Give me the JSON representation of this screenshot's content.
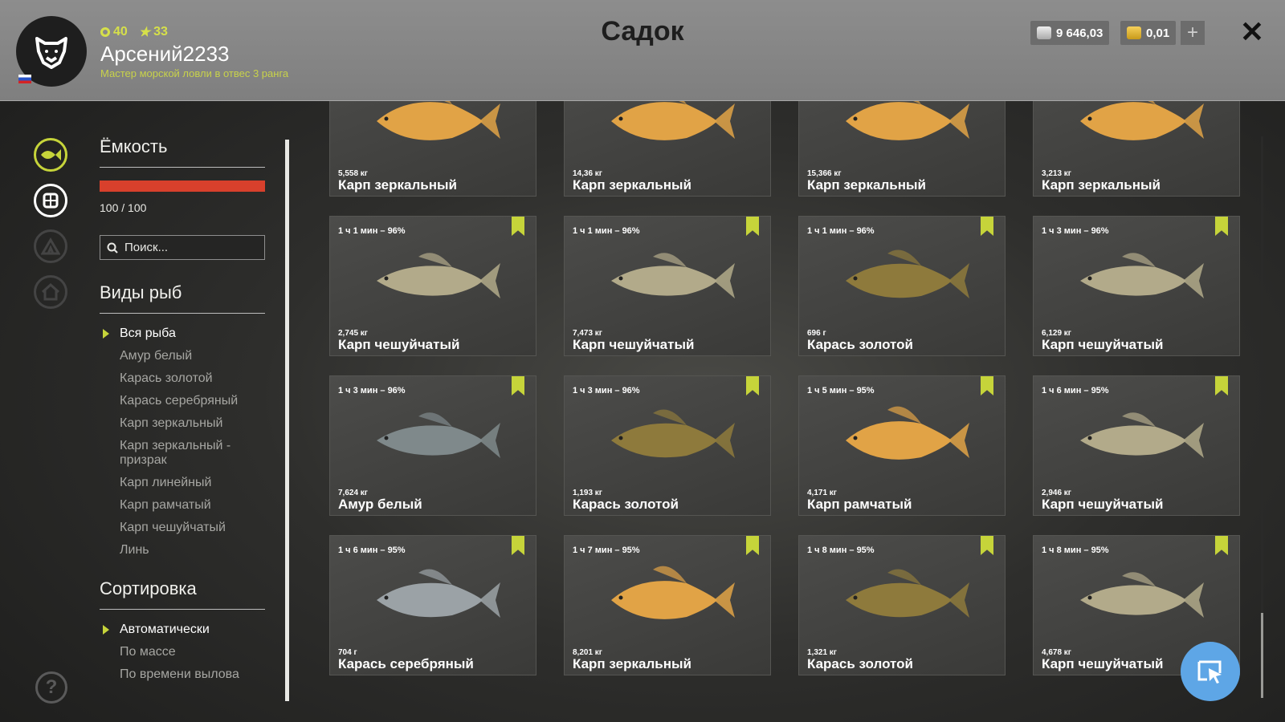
{
  "header": {
    "title": "Садок",
    "player": {
      "level": "40",
      "rank": "33",
      "name": "Арсений2233",
      "subtitle": "Мастер морской ловли в отвес 3 ранга"
    },
    "currency": {
      "silver": "9 646,03",
      "gold": "0,01"
    },
    "plus_label": "+",
    "close_label": "✕"
  },
  "sidebar": {
    "capacity_title": "Ёмкость",
    "capacity_value": "100 / 100",
    "capacity_fraction": 1.0,
    "search_placeholder": "Поиск...",
    "species_title": "Виды рыб",
    "species": [
      "Вся рыба",
      "Амур белый",
      "Карась золотой",
      "Карась серебряный",
      "Карп зеркальный",
      "Карп зеркальный - призрак",
      "Карп линейный",
      "Карп рамчатый",
      "Карп чешуйчатый",
      "Линь"
    ],
    "sort_title": "Сортировка",
    "sort_options": [
      "Автоматически",
      "По массе",
      "По времени вылова"
    ],
    "help_label": "?"
  },
  "fish": [
    {
      "time": "",
      "weight": "5,558 кг",
      "name": "Карп зеркальный",
      "kind": "mirror",
      "marked": false
    },
    {
      "time": "",
      "weight": "14,36 кг",
      "name": "Карп зеркальный",
      "kind": "mirror",
      "marked": false
    },
    {
      "time": "",
      "weight": "15,366 кг",
      "name": "Карп зеркальный",
      "kind": "mirror",
      "marked": false
    },
    {
      "time": "",
      "weight": "3,213 кг",
      "name": "Карп зеркальный",
      "kind": "mirror",
      "marked": false
    },
    {
      "time": "1 ч 1 мин – 96%",
      "weight": "2,745 кг",
      "name": "Карп чешуйчатый",
      "kind": "common",
      "marked": true
    },
    {
      "time": "1 ч 1 мин – 96%",
      "weight": "7,473 кг",
      "name": "Карп чешуйчатый",
      "kind": "common",
      "marked": true
    },
    {
      "time": "1 ч 1 мин – 96%",
      "weight": "696 г",
      "name": "Карась золотой",
      "kind": "crucian",
      "marked": true
    },
    {
      "time": "1 ч 3 мин – 96%",
      "weight": "6,129 кг",
      "name": "Карп чешуйчатый",
      "kind": "common",
      "marked": true
    },
    {
      "time": "1 ч 3 мин – 96%",
      "weight": "7,624 кг",
      "name": "Амур белый",
      "kind": "amur",
      "marked": true
    },
    {
      "time": "1 ч 3 мин – 96%",
      "weight": "1,193 кг",
      "name": "Карась золотой",
      "kind": "crucian",
      "marked": true
    },
    {
      "time": "1 ч 5 мин – 95%",
      "weight": "4,171 кг",
      "name": "Карп рамчатый",
      "kind": "mirror",
      "marked": true
    },
    {
      "time": "1 ч 6 мин – 95%",
      "weight": "2,946 кг",
      "name": "Карп чешуйчатый",
      "kind": "common",
      "marked": true
    },
    {
      "time": "1 ч 6 мин – 95%",
      "weight": "704 г",
      "name": "Карась серебряный",
      "kind": "silver",
      "marked": true
    },
    {
      "time": "1 ч 7 мин – 95%",
      "weight": "8,201 кг",
      "name": "Карп зеркальный",
      "kind": "mirror",
      "marked": true
    },
    {
      "time": "1 ч 8 мин – 95%",
      "weight": "1,321 кг",
      "name": "Карась золотой",
      "kind": "crucian",
      "marked": true
    },
    {
      "time": "1 ч 8 мин – 95%",
      "weight": "4,678 кг",
      "name": "Карп чешуйчатый",
      "kind": "common",
      "marked": true
    }
  ],
  "icons": {
    "rail": [
      "fish-icon",
      "keepnet-icon",
      "tent-icon",
      "home-icon"
    ],
    "bear": "bear-icon",
    "cursor": "cursor-icon"
  },
  "colors": {
    "accent": "#c6d43a",
    "capacity_bar": "#d8402c",
    "action_button": "#5ea6e6",
    "fish_palette": {
      "mirror": "#e1a346",
      "common": "#b2aa8a",
      "crucian": "#8e7a3c",
      "silver": "#9ba2a6",
      "amur": "#7f898b"
    }
  }
}
